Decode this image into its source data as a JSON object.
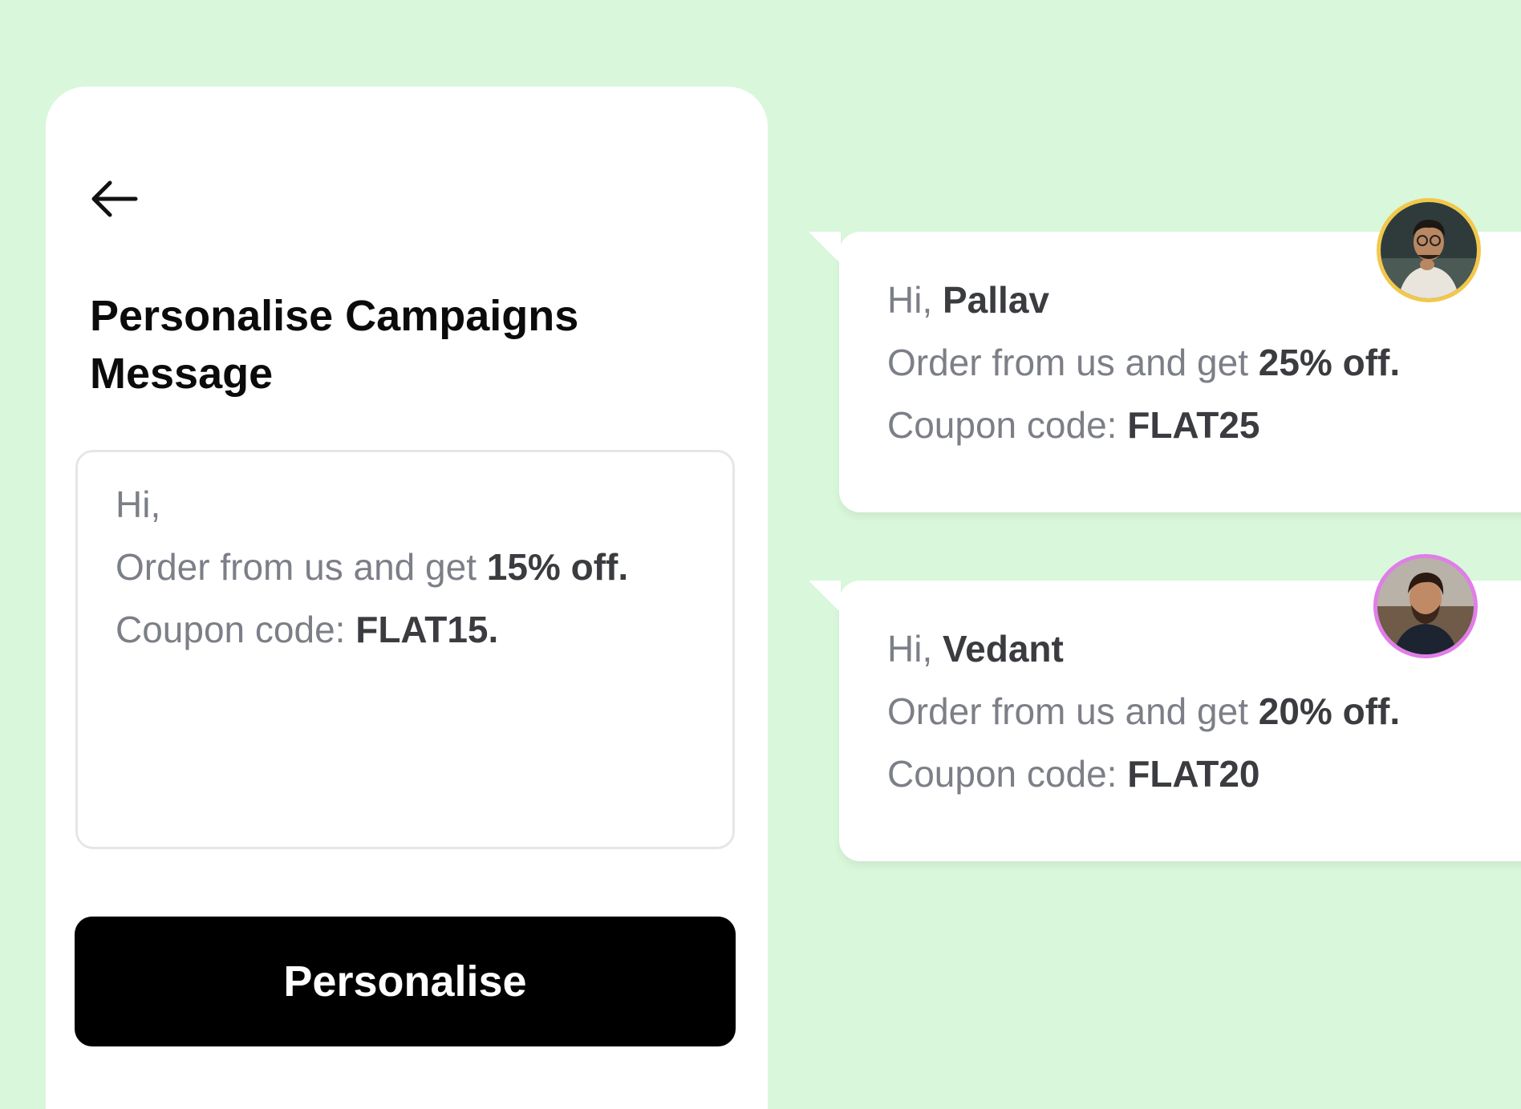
{
  "page": {
    "title": "Personalise Campaigns Message",
    "back_icon": "arrow-left-icon"
  },
  "template_message": {
    "greeting": "Hi,",
    "offer_prefix": "Order from us and get ",
    "offer_value": "15% off.",
    "coupon_prefix": "Coupon code: ",
    "coupon_value": "FLAT15."
  },
  "personalise_button": {
    "label": "Personalise"
  },
  "personalised_messages": [
    {
      "greeting_prefix": "Hi, ",
      "name": "Pallav",
      "offer_prefix": "Order from us and get ",
      "offer_value": "25% off.",
      "coupon_prefix": "Coupon code: ",
      "coupon_value": "FLAT25",
      "avatar_ring_color": "#f2c84b"
    },
    {
      "greeting_prefix": "Hi, ",
      "name": "Vedant",
      "offer_prefix": "Order from us and get ",
      "offer_value": "20% off.",
      "coupon_prefix": "Coupon code: ",
      "coupon_value": "FLAT20",
      "avatar_ring_color": "#e07ee8"
    }
  ],
  "colors": {
    "background": "#d9f7db",
    "button": "#000000",
    "muted_text": "#7c7f87",
    "strong_text": "#3b3c40"
  }
}
